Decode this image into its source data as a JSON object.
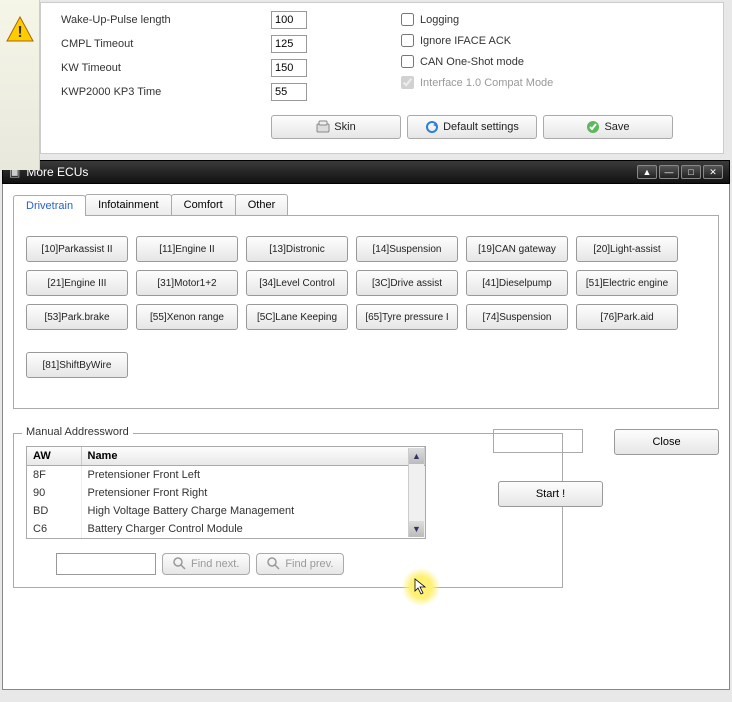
{
  "settings": {
    "fields": [
      {
        "label": "Wake-Up-Pulse length",
        "value": "100"
      },
      {
        "label": "CMPL Timeout",
        "value": "125"
      },
      {
        "label": "KW Timeout",
        "value": "150"
      },
      {
        "label": "KWP2000 KP3 Time",
        "value": "55"
      }
    ],
    "checks": {
      "logging": "Logging",
      "iface_ack": "Ignore IFACE ACK",
      "oneshot": "CAN One-Shot mode",
      "compat": "Interface 1.0 Compat Mode"
    },
    "buttons": {
      "skin": "Skin",
      "defaults": "Default settings",
      "save": "Save"
    }
  },
  "window": {
    "title": "More ECUs"
  },
  "tabs": [
    "Drivetrain",
    "Infotainment",
    "Comfort",
    "Other"
  ],
  "ecus": [
    "[10]Parkassist II",
    "[11]Engine II",
    "[13]Distronic",
    "[14]Suspension",
    "[19]CAN gateway",
    "[20]Light-assist",
    "[21]Engine III",
    "[31]Motor1+2",
    "[34]Level Control",
    "[3C]Drive assist",
    "[41]Dieselpump",
    "[51]Electric engine",
    "[53]Park.brake",
    "[55]Xenon range",
    "[5C]Lane Keeping",
    "[65]Tyre pressure I",
    "[74]Suspension",
    "[76]Park.aid",
    "[81]ShiftByWire"
  ],
  "manual": {
    "legend": "Manual Addressword",
    "headers": {
      "aw": "AW",
      "name": "Name"
    },
    "rows": [
      {
        "aw": "8F",
        "name": "Pretensioner Front Left"
      },
      {
        "aw": "90",
        "name": "Pretensioner Front Right"
      },
      {
        "aw": "BD",
        "name": "High Voltage Battery Charge Management"
      },
      {
        "aw": "C6",
        "name": "Battery Charger Control Module"
      }
    ],
    "find_next": "Find next.",
    "find_prev": "Find prev."
  },
  "side": {
    "close": "Close",
    "start": "Start !"
  }
}
